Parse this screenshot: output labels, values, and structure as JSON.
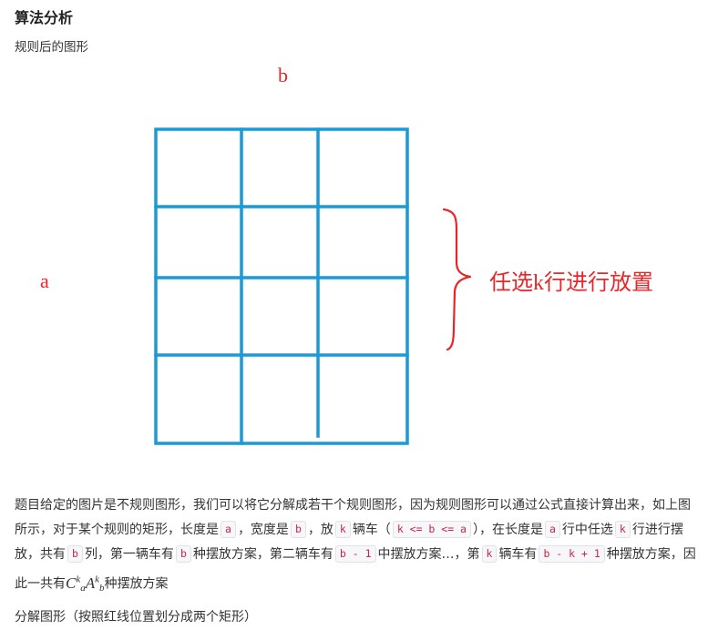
{
  "heading": "算法分析",
  "subtitle": "规则后的图形",
  "figure": {
    "label_b": "b",
    "label_a": "a",
    "brace_text": "任选k行进行放置",
    "grid_color": "#1a9ad6",
    "label_color": "#e8262a"
  },
  "paragraph": {
    "p1": "题目给定的图片是不规则图形，我们可以将它分解成若干个规则图形，因为规则图形可以通过公式直接计算出来，如上图所示，对于某个规则的矩形，长度是",
    "c1": "a",
    "p2": "，宽度是",
    "c2": "b",
    "p3": "，放",
    "c3": "k",
    "p4": "辆车（",
    "c4": "k <= b <= a",
    "p5": "），在长度是",
    "c5": "a",
    "p6": "行中任选",
    "c6": "k",
    "p7": "行进行摆放，共有",
    "c7": "b",
    "p8": "列，第一辆车有",
    "c8": "b",
    "p9": "种摆放方案，第二辆车有",
    "c9": "b - 1",
    "p10": "中摆放方案…，第",
    "c10": "k",
    "p11": "辆车有",
    "c11": "b - k + 1",
    "p12": "种摆放方案，因此一共有",
    "m_C": "C",
    "m_k1": "k",
    "m_a": "a",
    "m_A": "A",
    "m_k2": "k",
    "m_b": "b",
    "p13": "种摆放方案"
  },
  "footer": "分解图形（按照红线位置划分成两个矩形）"
}
